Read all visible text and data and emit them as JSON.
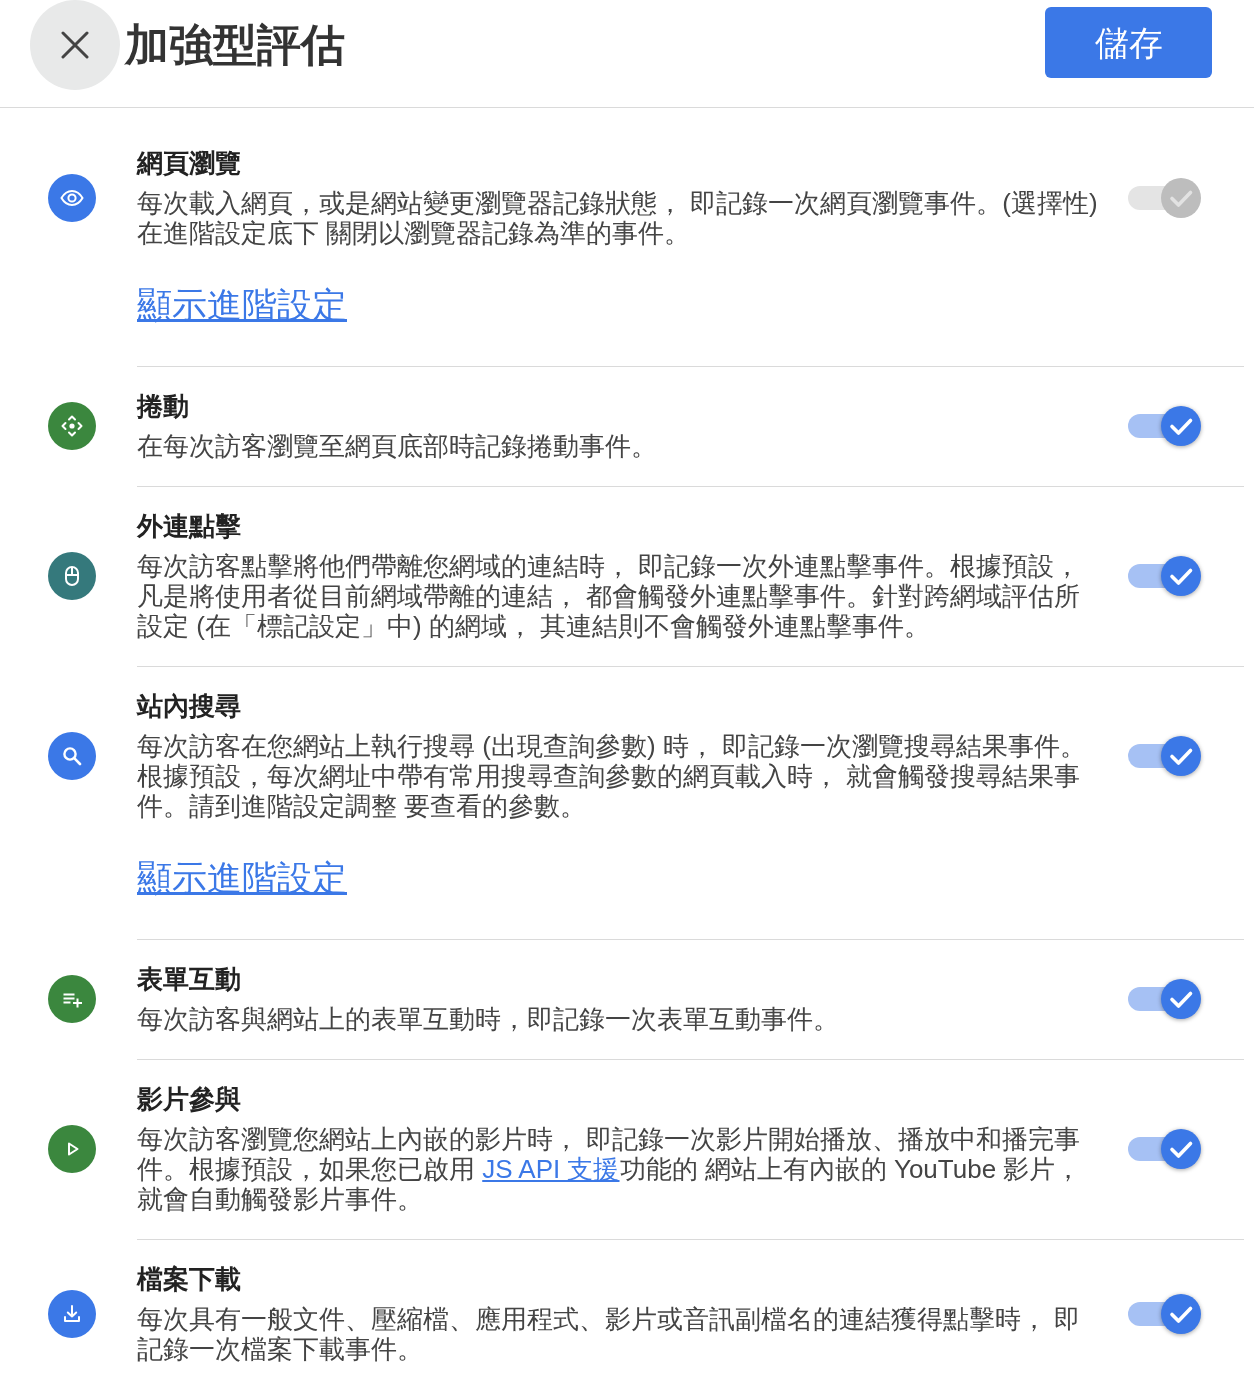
{
  "header": {
    "title": "加強型評估",
    "save_button": "儲存"
  },
  "events": [
    {
      "kind": "eye",
      "color": "#3b78e7",
      "title": "網頁瀏覽",
      "description": "每次載入網頁，或是網站變更瀏覽器記錄狀態， 即記錄一次網頁瀏覽事件。(選擇性)在進階設定底下 關閉以瀏覽器記錄為準的事件。",
      "link": "顯示進階設定",
      "on": true,
      "disabled": true
    },
    {
      "kind": "arrows",
      "color": "#3b873e",
      "title": "捲動",
      "description": "在每次訪客瀏覽至網頁底部時記錄捲動事件。",
      "on": true,
      "disabled": false
    },
    {
      "kind": "mouse",
      "color": "#35797c",
      "title": "外連點擊",
      "description": "每次訪客點擊將他們帶離您網域的連結時， 即記錄一次外連點擊事件。根據預設，凡是將使用者從目前網域帶離的連結， 都會觸發外連點擊事件。針對跨網域評估所設定 (在「標記設定」中) 的網域， 其連結則不會觸發外連點擊事件。",
      "on": true,
      "disabled": false
    },
    {
      "kind": "search",
      "color": "#3b78e7",
      "title": "站內搜尋",
      "description": "每次訪客在您網站上執行搜尋 (出現查詢參數) 時， 即記錄一次瀏覽搜尋結果事件。根據預設，每次網址中帶有常用搜尋查詢參數的網頁載入時， 就會觸發搜尋結果事件。請到進階設定調整 要查看的參數。",
      "link": "顯示進階設定",
      "on": true,
      "disabled": false
    },
    {
      "kind": "listplus",
      "color": "#3b873e",
      "title": "表單互動",
      "description": "每次訪客與網站上的表單互動時，即記錄一次表單互動事件。",
      "on": true,
      "disabled": false
    },
    {
      "kind": "play",
      "color": "#3b873e",
      "title": "影片參與",
      "description": [
        {
          "kind": "text",
          "text": "每次訪客瀏覽您網站上內嵌的影片時， 即記錄一次影片開始播放、播放中和播完事件。根據預設，如果您已啟用 "
        },
        {
          "kind": "link",
          "text": "JS API 支援"
        },
        {
          "kind": "text",
          "text": "功能的 網站上有內嵌的 YouTube 影片，就會自動觸發影片事件。"
        }
      ],
      "on": true,
      "disabled": false
    },
    {
      "kind": "download",
      "color": "#3b78e7",
      "title": "檔案下載",
      "description": "每次具有一般文件、壓縮檔、應用程式、影片或音訊副檔名的連結獲得點擊時， 即記錄一次檔案下載事件。",
      "on": true,
      "disabled": false
    }
  ]
}
